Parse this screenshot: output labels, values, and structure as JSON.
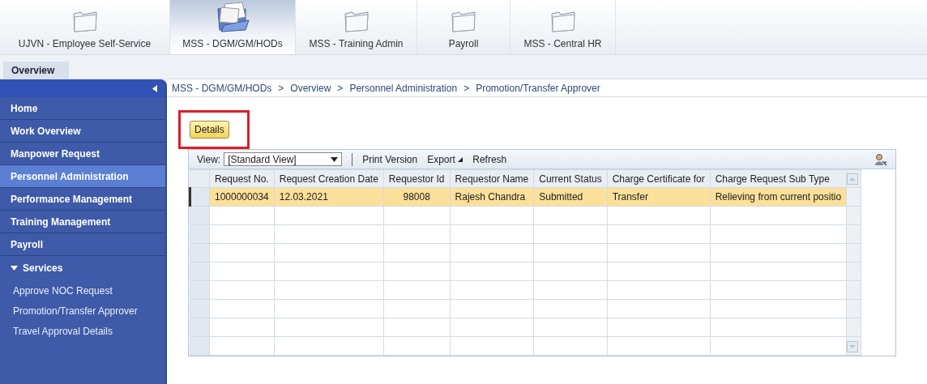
{
  "top_tabs": [
    {
      "label": "UJVN - Employee Self-Service",
      "selected": false
    },
    {
      "label": "MSS - DGM/GM/HODs",
      "selected": true
    },
    {
      "label": "MSS - Training Admin",
      "selected": false
    },
    {
      "label": "Payroll",
      "selected": false
    },
    {
      "label": "MSS - Central HR",
      "selected": false
    }
  ],
  "sub_tabs": [
    {
      "label": "Overview",
      "selected": true
    }
  ],
  "breadcrumb": [
    "MSS - DGM/GM/HODs",
    "Overview",
    "Personnel Administration",
    "Promotion/Transfer Approver"
  ],
  "breadcrumb_separator": ">",
  "sidebar": {
    "items": [
      {
        "label": "Home",
        "selected": false
      },
      {
        "label": "Work Overview",
        "selected": false
      },
      {
        "label": "Manpower Request",
        "selected": false
      },
      {
        "label": "Personnel Administration",
        "selected": true
      },
      {
        "label": "Performance Management",
        "selected": false
      },
      {
        "label": "Training Management",
        "selected": false
      },
      {
        "label": "Payroll",
        "selected": false
      }
    ],
    "services": {
      "label": "Services",
      "expanded": true,
      "items": [
        "Approve NOC Request",
        "Promotion/Transfer Approver",
        "Travel Approval Details"
      ]
    }
  },
  "details_button": "Details",
  "toolbar": {
    "view_label": "View:",
    "view_value": "[Standard View]",
    "buttons": [
      "Print Version",
      "Export",
      "Refresh"
    ]
  },
  "table": {
    "columns": [
      "Request No.",
      "Request Creation Date",
      "Requestor Id",
      "Requestor Name",
      "Current Status",
      "Charge Certificate for",
      "Charge Request Sub Type"
    ],
    "rows": [
      {
        "selected": true,
        "cells": [
          "1000000034",
          "12.03.2021",
          "98008",
          "Rajesh Chandra",
          "Submitted",
          "Transfer",
          "Relieving from current positio"
        ]
      }
    ]
  }
}
